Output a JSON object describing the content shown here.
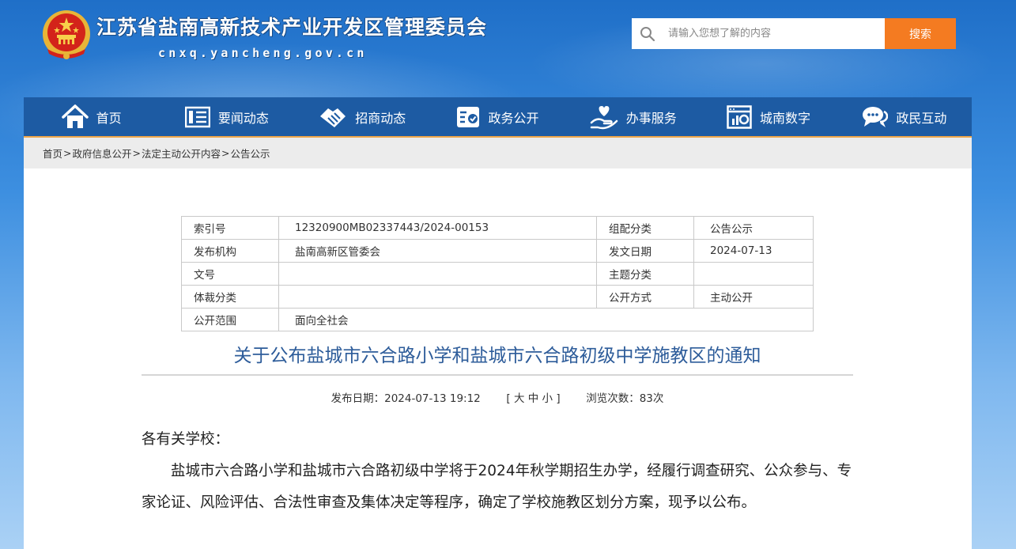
{
  "header": {
    "site_title": "江苏省盐南高新技术产业开发区管理委员会",
    "site_domain": "cnxq.yancheng.gov.cn",
    "search_placeholder": "请输入您想了解的内容",
    "search_button": "搜索"
  },
  "nav": {
    "items": [
      {
        "label": "首页",
        "icon": "home-icon"
      },
      {
        "label": "要闻动态",
        "icon": "news-icon"
      },
      {
        "label": "招商动态",
        "icon": "handshake-icon"
      },
      {
        "label": "政务公开",
        "icon": "checklist-icon"
      },
      {
        "label": "办事服务",
        "icon": "hand-heart-icon"
      },
      {
        "label": "城南数字",
        "icon": "data-screen-icon"
      },
      {
        "label": "政民互动",
        "icon": "chat-icon"
      }
    ]
  },
  "breadcrumb": {
    "items": [
      "首页",
      "政府信息公开",
      "法定主动公开内容",
      "公告公示"
    ],
    "separator": ">"
  },
  "meta": {
    "index_no_label": "索引号",
    "index_no": "12320900MB02337443/2024-00153",
    "category_label": "组配分类",
    "category": "公告公示",
    "publisher_label": "发布机构",
    "publisher": "盐南高新区管委会",
    "issue_date_label": "发文日期",
    "issue_date": "2024-07-13",
    "doc_no_label": "文号",
    "doc_no": "",
    "topic_label": "主题分类",
    "topic": "",
    "genre_label": "体裁分类",
    "genre": "",
    "disclosure_label": "公开方式",
    "disclosure": "主动公开",
    "scope_label": "公开范围",
    "scope": "面向全社会"
  },
  "article": {
    "title": "关于公布盐城市六合路小学和盐城市六合路初级中学施教区的通知",
    "publish_label": "发布日期：",
    "publish_time": "2024-07-13 19:12",
    "size_open": "[",
    "size_large": "大",
    "size_medium": "中",
    "size_small": "小",
    "size_close": "]",
    "views_label": "浏览次数：",
    "views": "83次",
    "salutation": "各有关学校：",
    "paragraph1": "盐城市六合路小学和盐城市六合路初级中学将于2024年秋学期招生办学，经履行调查研究、公众参与、专家论证、风险评估、合法性审查及集体决定等程序，确定了学校施教区划分方案，现予以公布。"
  },
  "colors": {
    "nav_bg": "#1d5ba3",
    "nav_accent": "#eea64a",
    "search_button": "#f47b21",
    "title_color": "#2d5c9a"
  }
}
